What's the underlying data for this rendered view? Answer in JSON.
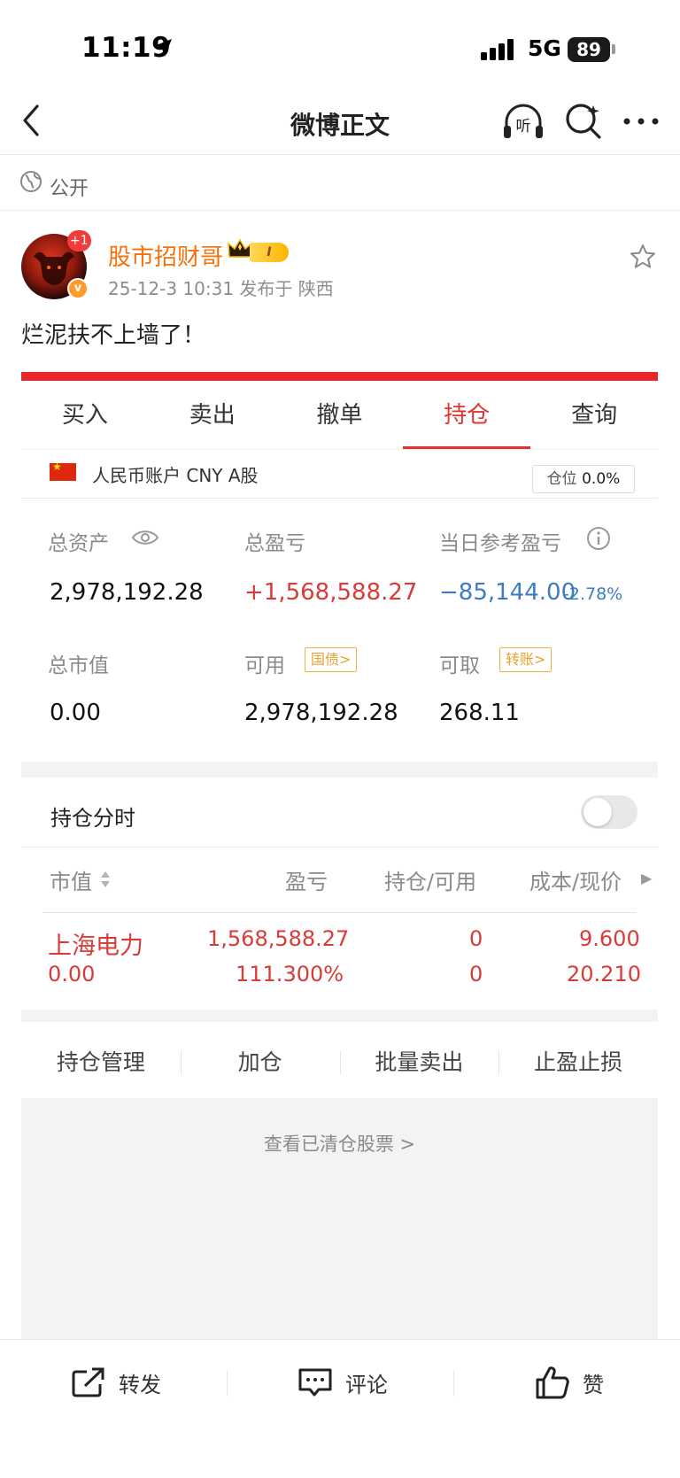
{
  "status_bar": {
    "time": "11:19",
    "network": "5G",
    "battery": "89"
  },
  "nav": {
    "title": "微博正文",
    "listen_icon_text": "听"
  },
  "visibility": {
    "label": "公开"
  },
  "author": {
    "name": "股市招财哥",
    "avatar_badge": "+1",
    "level_badge": "I",
    "post_time": "25-12-3 10:31",
    "location": "发布于 陕西",
    "meta": "25-12-3 10:31  发布于 陕西"
  },
  "post": {
    "text": "烂泥扶不上墙了！"
  },
  "trade": {
    "tabs": [
      {
        "label": "买入",
        "active": false
      },
      {
        "label": "卖出",
        "active": false
      },
      {
        "label": "撤单",
        "active": false
      },
      {
        "label": "持仓",
        "active": true
      },
      {
        "label": "查询",
        "active": false
      }
    ],
    "account": {
      "label": "人民币账户 CNY A股",
      "position_label": "仓位",
      "position_value": "0.0%"
    },
    "summary": {
      "total_assets_label": "总资产",
      "total_assets": "2,978,192.28",
      "total_pnl_label": "总盈亏",
      "total_pnl": "+1,568,588.27",
      "daily_pnl_label": "当日参考盈亏",
      "daily_pnl": "−85,144.00",
      "daily_pnl_pct": "-2.78%",
      "market_value_label": "总市值",
      "market_value": "0.00",
      "available_label": "可用",
      "available": "2,978,192.28",
      "available_tag": "国债>",
      "withdrawable_label": "可取",
      "withdrawable": "268.11",
      "withdrawable_tag": "转账>"
    },
    "holdings": {
      "title": "持仓分时",
      "toggle_on": false,
      "headers": {
        "market_value": "市值",
        "pnl": "盈亏",
        "position": "持仓/可用",
        "cost_price": "成本/现价"
      },
      "rows": [
        {
          "name": "上海电力",
          "market_value": "0.00",
          "pnl": "1,568,588.27",
          "pnl_pct": "111.300%",
          "position": "0",
          "available": "0",
          "cost": "9.600",
          "price": "20.210"
        }
      ]
    },
    "actions": [
      "持仓管理",
      "加仓",
      "批量卖出",
      "止盈止损"
    ],
    "cleared_link": "查看已清仓股票 >"
  },
  "bottom_bar": {
    "repost": "转发",
    "comment": "评论",
    "like": "赞"
  },
  "colors": {
    "brand_red": "#e8252c",
    "up_red": "#d93b38",
    "down_blue": "#3d7cc5",
    "author_orange": "#f5700a",
    "tag_gold": "#e8a12c"
  }
}
